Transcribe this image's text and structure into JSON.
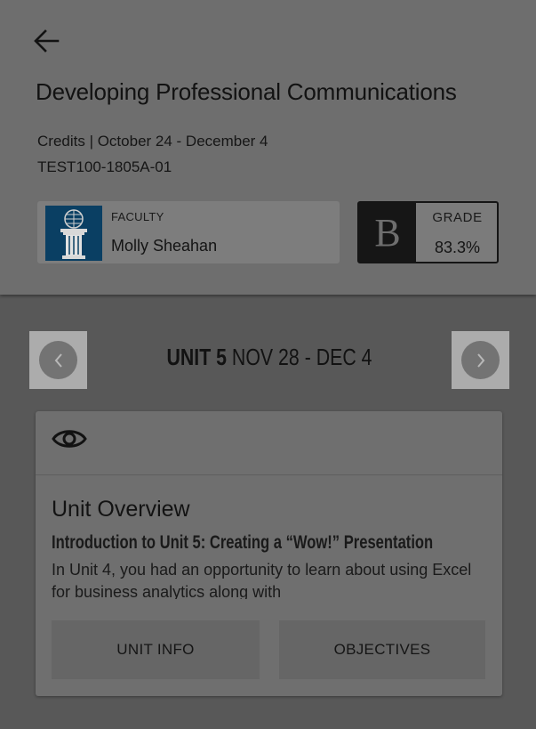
{
  "header": {
    "back_icon": "arrow-left-icon",
    "course_title": "Developing Professional Communications",
    "credits_line": "Credits | October 24 - December 4",
    "course_code": "TEST100-1805A-01"
  },
  "faculty": {
    "label": "FACULTY",
    "name": "Molly Sheahan",
    "logo_icon": "university-column-logo",
    "logo_color": "#0a3f63"
  },
  "grade": {
    "letter": "B",
    "label": "GRADE",
    "percent": "83.3%"
  },
  "unit_nav": {
    "unit_label": "UNIT 5",
    "date_range": "NOV 28 - DEC 4",
    "prev_icon": "chevron-left-icon",
    "next_icon": "chevron-right-icon"
  },
  "overview": {
    "icon": "eye-icon",
    "title": "Unit Overview",
    "subtitle": "Introduction to Unit 5:  Creating a “Wow!” Presentation",
    "excerpt": "In Unit 4, you had an opportunity to learn about using Excel for business analytics along with",
    "buttons": {
      "unit_info": "UNIT INFO",
      "objectives": "OBJECTIVES"
    }
  }
}
